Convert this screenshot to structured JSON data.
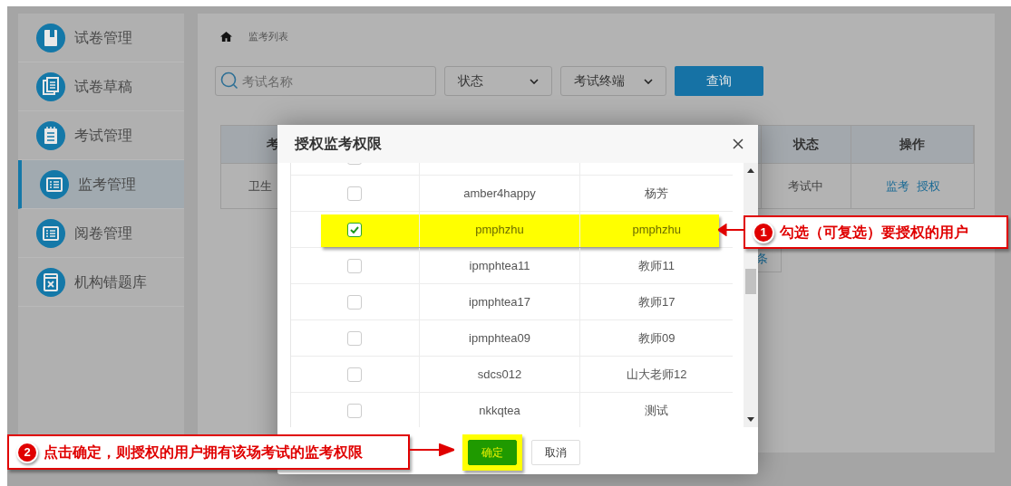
{
  "sidebar": {
    "items": [
      {
        "label": "试卷管理",
        "selected": false
      },
      {
        "label": "试卷草稿",
        "selected": false
      },
      {
        "label": "考试管理",
        "selected": false
      },
      {
        "label": "监考管理",
        "selected": true
      },
      {
        "label": "阅卷管理",
        "selected": false
      },
      {
        "label": "机构错题库",
        "selected": false
      }
    ]
  },
  "breadcrumb": {
    "label": "监考列表"
  },
  "filters": {
    "search": {
      "placeholder": "考试名称"
    },
    "selects": [
      "状态",
      "考试终端"
    ],
    "query_button": "查询"
  },
  "table": {
    "columns": [
      "考",
      "状态",
      "操作"
    ],
    "rows": [
      {
        "cells": [
          "卫生",
          "考试中"
        ],
        "actions": [
          "监考",
          "授权"
        ]
      }
    ]
  },
  "pagination": {
    "text": "条"
  },
  "modal": {
    "title": "授权监考权限",
    "rows": [
      {
        "checked": false,
        "highlighted": false
      },
      {
        "username": "amber4happy",
        "name": "杨芳",
        "checked": false,
        "highlighted": false
      },
      {
        "username": "pmphzhu",
        "name": "pmphzhu",
        "checked": true,
        "highlighted": true
      },
      {
        "username": "ipmphtea11",
        "name": "教师11",
        "checked": false,
        "highlighted": false
      },
      {
        "username": "ipmphtea17",
        "name": "教师17",
        "checked": false,
        "highlighted": false
      },
      {
        "username": "ipmphtea09",
        "name": "教师09",
        "checked": false,
        "highlighted": false
      },
      {
        "username": "sdcs012",
        "name": "山大老师12",
        "checked": false,
        "highlighted": false
      },
      {
        "username": "nkkqtea",
        "name": "测试",
        "checked": false,
        "highlighted": false
      }
    ],
    "buttons": [
      {
        "label": "确定",
        "kind": "primary",
        "highlighted": true
      },
      {
        "label": "取消",
        "kind": "default",
        "highlighted": false
      }
    ]
  },
  "annotations": [
    {
      "number": "1",
      "text": "勾选（可复选）要授权的用户"
    },
    {
      "number": "2",
      "text": "点击确定，则授权的用户拥有该场考试的监考权限"
    }
  ]
}
